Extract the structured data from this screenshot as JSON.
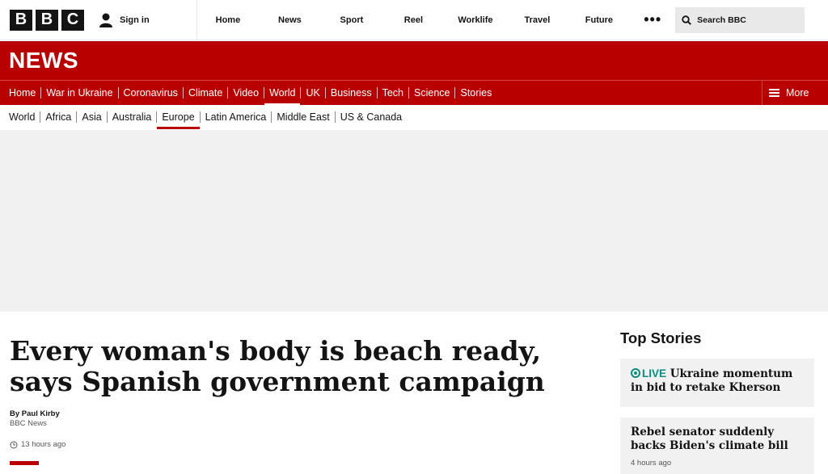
{
  "topbar": {
    "logo_letters": [
      "B",
      "B",
      "C"
    ],
    "signin_label": "Sign in",
    "nav": [
      "Home",
      "News",
      "Sport",
      "Reel",
      "Worklife",
      "Travel",
      "Future"
    ],
    "more_label": "•••",
    "search_label": "Search BBC"
  },
  "news_header": {
    "brand": "NEWS"
  },
  "primary_nav": {
    "items": [
      "Home",
      "War in Ukraine",
      "Coronavirus",
      "Climate",
      "Video",
      "World",
      "UK",
      "Business",
      "Tech",
      "Science",
      "Stories"
    ],
    "active": "World",
    "more_label": "More"
  },
  "secondary_nav": {
    "items": [
      "World",
      "Africa",
      "Asia",
      "Australia",
      "Europe",
      "Latin America",
      "Middle East",
      "US & Canada"
    ],
    "active": "Europe"
  },
  "article": {
    "headline_line1": "Every woman's body is beach ready,",
    "headline_line2": "says Spanish government campaign",
    "author": "By Paul Kirby",
    "org": "BBC News",
    "time": "13 hours ago"
  },
  "top_stories": {
    "title": "Top Stories",
    "items": [
      {
        "live": "LIVE",
        "text": "Ukraine momentum in bid to retake Kherson"
      },
      {
        "text": "Rebel senator suddenly backs Biden's climate bill",
        "time": "4 hours ago"
      }
    ]
  },
  "colors": {
    "brand_red": "#b80000",
    "live_teal": "#0b8c7f"
  }
}
